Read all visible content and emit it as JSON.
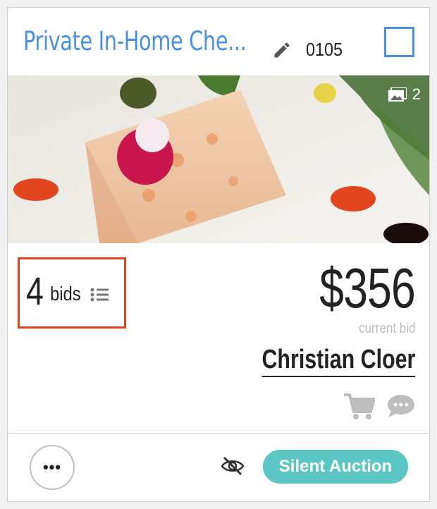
{
  "item": {
    "title": "Private In-Home Che...",
    "number": "0105",
    "image_count": "2"
  },
  "bids": {
    "count": "4",
    "label": "bids"
  },
  "pricing": {
    "current_bid": "$356",
    "caption": "current bid",
    "bidder": "Christian Cloer"
  },
  "footer": {
    "more_label": "•••",
    "auction_type": "Silent Auction"
  },
  "colors": {
    "accent": "#4a90e2",
    "highlight": "#e2421e",
    "pill": "#5bc6c4",
    "muted": "#bdbdbd"
  },
  "icons": [
    "pencil-icon",
    "checkbox",
    "image-gallery-icon",
    "list-icon",
    "cart-icon",
    "chat-icon",
    "ellipsis-icon",
    "eye-slash-icon"
  ]
}
